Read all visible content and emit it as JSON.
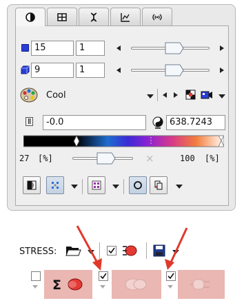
{
  "tabs": [
    {
      "icon": "contrast-icon",
      "active": true
    },
    {
      "icon": "grid-icon",
      "active": false
    },
    {
      "icon": "dna-icon",
      "active": false
    },
    {
      "icon": "chart-icon",
      "active": false
    },
    {
      "icon": "signal-icon",
      "active": false
    }
  ],
  "rows": {
    "row1": {
      "value": "15",
      "step": "1",
      "slider_fraction": 0.55,
      "color": "#2a3dd6"
    },
    "row2": {
      "value": "9",
      "step": "1",
      "slider_fraction": 0.55,
      "color": "#2a3dd6"
    }
  },
  "colormap": {
    "name": "Cool",
    "min_label": "Ⅱ",
    "min_value": "-0.0",
    "max_value": "638.7243"
  },
  "threshold": {
    "low_value": "27",
    "low_unit": "[%]",
    "high_value": "100",
    "high_unit": "[%]",
    "close_symbol": "×"
  },
  "stress": {
    "label": "STRESS:"
  },
  "colors": {
    "accent_blue": "#2a3dd6",
    "pink": "#eab7b2",
    "red_arrow": "#e0392b"
  }
}
